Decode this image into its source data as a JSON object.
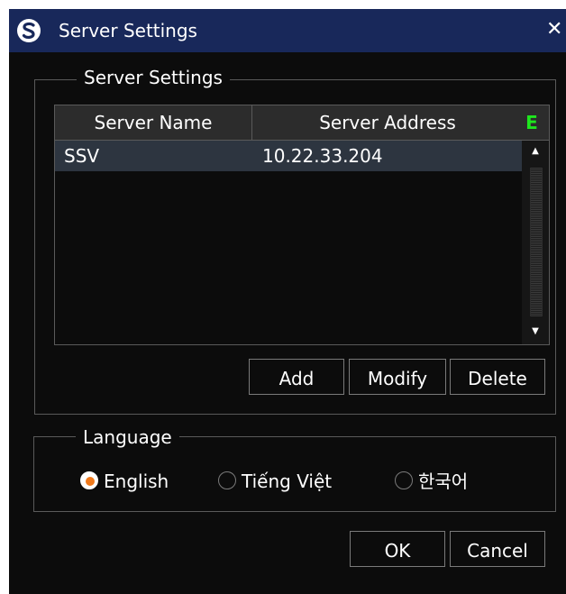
{
  "window": {
    "title": "Server Settings",
    "close_symbol": "✕",
    "logo_icon": "s-logo-icon"
  },
  "server_group": {
    "label": "Server Settings",
    "grid": {
      "columns": [
        "Server Name",
        "Server Address"
      ],
      "badge": "E",
      "rows": [
        {
          "name": "SSV",
          "address": "10.22.33.204"
        }
      ]
    },
    "buttons": {
      "add": "Add",
      "modify": "Modify",
      "delete": "Delete"
    }
  },
  "language_group": {
    "label": "Language",
    "options": [
      {
        "label": "English",
        "selected": true
      },
      {
        "label": "Tiếng Việt",
        "selected": false
      },
      {
        "label": "한국어",
        "selected": false
      }
    ]
  },
  "footer": {
    "ok": "OK",
    "cancel": "Cancel"
  },
  "colors": {
    "title_bar": "#18285a",
    "background": "#0c0c0c",
    "selected_row": "#2d3540",
    "radio_accent": "#f07a1c",
    "badge_green": "#1ee61e"
  }
}
